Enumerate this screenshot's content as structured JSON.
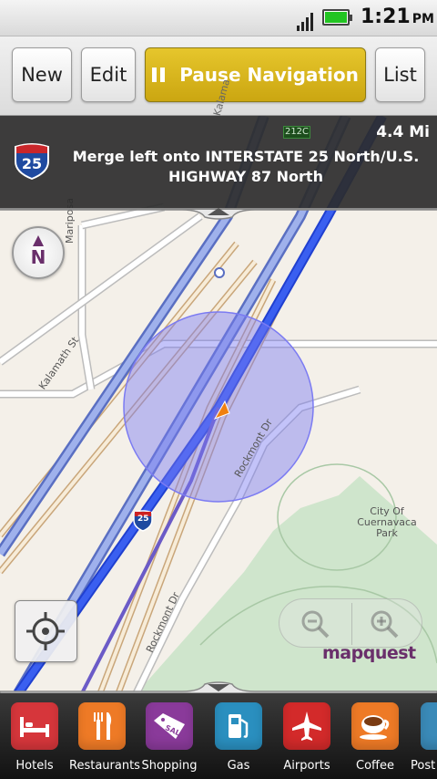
{
  "status": {
    "time": "1:21",
    "ampm": "PM"
  },
  "toolbar": {
    "new_label": "New",
    "edit_label": "Edit",
    "pause_label": "Pause Navigation",
    "list_label": "List"
  },
  "directions": {
    "distance": "4.4 Mi",
    "instruction": "Merge left onto INTERSTATE 25 North/U.S. HIGHWAY 87 North",
    "shield_number": "25",
    "exit_label": "212C"
  },
  "map": {
    "streets": {
      "mariposa": "Mariposa",
      "kalamath_st": "Kalamath St",
      "kalamath_top": "Kalama",
      "rockmont_upper": "Rockmont Dr",
      "rockmont_lower": "Rockmont Dr",
      "interstate_marker": "25"
    },
    "park_name": "City Of Cuernavaca Park",
    "compass_letter": "N",
    "brand": "mapquest",
    "colors": {
      "route": "#3a5ff0",
      "accuracy_circle": "#7b7bf2",
      "park": "#cfe5cc",
      "brand": "#6a2f6b"
    }
  },
  "categories": [
    {
      "label": "Hotels",
      "icon": "bed-icon",
      "color": "#d6363b"
    },
    {
      "label": "Restaurants",
      "icon": "fork-knife-icon",
      "color": "#ee7a26"
    },
    {
      "label": "Shopping",
      "icon": "sale-tag-icon",
      "color": "#8a3a9a"
    },
    {
      "label": "Gas",
      "icon": "gas-pump-icon",
      "color": "#2a8fbf"
    },
    {
      "label": "Airports",
      "icon": "airplane-icon",
      "color": "#d32a2a"
    },
    {
      "label": "Coffee",
      "icon": "coffee-cup-icon",
      "color": "#ee7a26"
    },
    {
      "label": "Post",
      "icon": "post-icon",
      "color": "#3a8ab8"
    }
  ]
}
